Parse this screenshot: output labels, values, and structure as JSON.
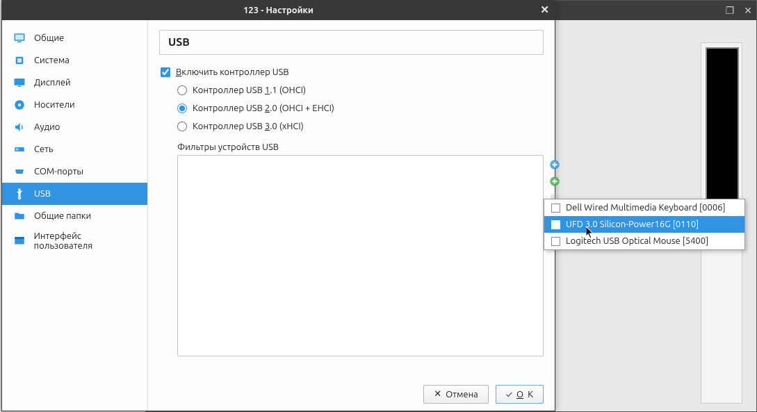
{
  "bg": {
    "maximize": "❐",
    "close": "✕"
  },
  "dialog": {
    "title": "123 - Настройки",
    "close": "✕"
  },
  "sidebar": {
    "items": [
      {
        "label": "Общие"
      },
      {
        "label": "Система"
      },
      {
        "label": "Дисплей"
      },
      {
        "label": "Носители"
      },
      {
        "label": "Аудио"
      },
      {
        "label": "Сеть"
      },
      {
        "label": "COM-порты"
      },
      {
        "label": "USB"
      },
      {
        "label": "Общие папки"
      },
      {
        "label": "Интерфейс пользователя"
      }
    ]
  },
  "panel": {
    "title": "USB",
    "enable_pre": "В",
    "enable_rest": "ключить контроллер USB",
    "r1_pre": "Контроллер USB ",
    "r1_u": "1",
    "r1_rest": ".1 (OHCI)",
    "r2_pre": "Контроллер USB ",
    "r2_u": "2",
    "r2_rest": ".0 (OHCI + EHCI)",
    "r3_pre": "Контроллер USB ",
    "r3_u": "3",
    "r3_rest": ".0 (xHCI)",
    "filters_label": "Фильтры устройств USB"
  },
  "buttons": {
    "cancel_pre": "✕  ",
    "cancel": "Отмена",
    "ok_pre": "✓  ",
    "ok_u": "O",
    "ok_rest": "K"
  },
  "popup": {
    "items": [
      {
        "label": "Dell Wired Multimedia Keyboard [0006]"
      },
      {
        "label": "UFD 3.0 Silicon-Power16G [0110]"
      },
      {
        "label": "Logitech USB Optical Mouse [5400]"
      }
    ]
  }
}
